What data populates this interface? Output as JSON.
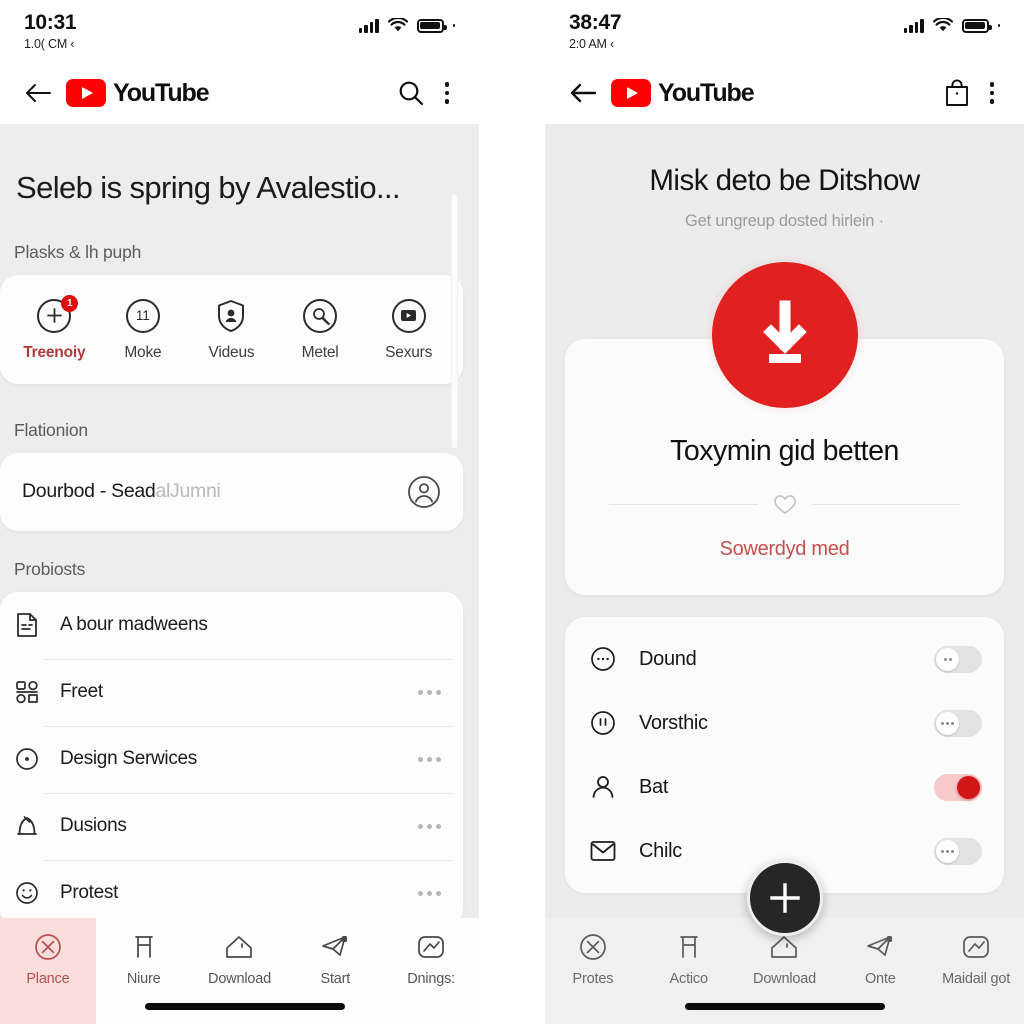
{
  "left": {
    "status": {
      "time": "10:31",
      "subtitle": "1.0( CM ‹",
      "signal_icon": "cellular-bars-icon",
      "wifi_icon": "wifi-icon",
      "battery_icon": "battery-full-icon"
    },
    "appbar": {
      "back_icon": "back-arrow-icon",
      "brand": "YouTube",
      "search_icon": "search-icon",
      "menu_icon": "kebab-menu-icon"
    },
    "page_title": "Seleb is spring by Avalestio...",
    "sections": {
      "quick_label": "Plasks & lh puph",
      "search_label": "Flationion",
      "list_label": "Probiosts"
    },
    "quick_actions": [
      {
        "label": "Treenoiy",
        "icon": "plus-circle-icon",
        "badge": "1",
        "active": true
      },
      {
        "label": "Moke",
        "icon": "number-eleven-circle-icon",
        "badge": "",
        "active": false
      },
      {
        "label": "Videus",
        "icon": "shield-person-icon",
        "badge": "",
        "active": false
      },
      {
        "label": "Metel",
        "icon": "search-circle-icon",
        "badge": "",
        "active": false
      },
      {
        "label": "Sexurs",
        "icon": "media-card-circle-icon",
        "badge": "",
        "active": false
      }
    ],
    "search": {
      "value": "Dourbod - Sead",
      "ghost": "alJumni",
      "avatar_icon": "account-circle-icon"
    },
    "list": [
      {
        "label": "A bour madweens",
        "icon": "document-lines-icon",
        "more": false
      },
      {
        "label": "Freet",
        "icon": "grid-shapes-icon",
        "more": true
      },
      {
        "label": "Design Serwices",
        "icon": "dot-circle-icon",
        "more": true
      },
      {
        "label": "Dusions",
        "icon": "bell-dome-icon",
        "more": true
      },
      {
        "label": "Protest",
        "icon": "smiley-face-icon",
        "more": true
      }
    ],
    "tabs": [
      {
        "label": "Plance",
        "icon": "x-circle-icon",
        "active": true
      },
      {
        "label": "Niure",
        "icon": "stool-icon",
        "active": false
      },
      {
        "label": "Download",
        "icon": "house-icon",
        "active": false
      },
      {
        "label": "Start",
        "icon": "paper-plane-icon",
        "active": false
      },
      {
        "label": "Dnings:",
        "icon": "chart-square-icon",
        "active": false
      }
    ]
  },
  "right": {
    "status": {
      "time": "38:47",
      "subtitle": "2:0 AM ‹",
      "signal_icon": "cellular-bars-icon",
      "wifi_icon": "wifi-icon",
      "battery_icon": "battery-full-icon"
    },
    "appbar": {
      "back_icon": "back-arrow-icon",
      "brand": "YouTube",
      "bag_icon": "shopping-bag-icon",
      "menu_icon": "kebab-menu-icon"
    },
    "page_title": "Misk deto be Ditshow",
    "page_subtitle": "Get ungreup dosted hirlein ·",
    "download_icon": "download-circle-icon",
    "hero": {
      "heading": "Toxymin gid betten",
      "divider_icon": "heart-outline-icon",
      "link": "Sowerdyd med"
    },
    "settings": [
      {
        "label": "Dound",
        "icon": "chat-dots-circle-icon",
        "on": false
      },
      {
        "label": "Vorsthic",
        "icon": "pause-circle-icon",
        "on": false
      },
      {
        "label": "Bat",
        "icon": "person-icon",
        "on": true
      },
      {
        "label": "Chilc",
        "icon": "mail-envelope-icon",
        "on": false
      }
    ],
    "fab": {
      "icon": "plus-icon"
    },
    "tabs": [
      {
        "label": "Protes",
        "icon": "x-circle-icon",
        "active": false
      },
      {
        "label": "Actico",
        "icon": "stool-icon",
        "active": false
      },
      {
        "label": "Download",
        "icon": "house-icon",
        "active": false
      },
      {
        "label": "Onte",
        "icon": "paper-plane-icon",
        "active": false
      },
      {
        "label": "Maidail got",
        "icon": "chart-square-icon",
        "active": false
      }
    ]
  },
  "colors": {
    "brand_red": "#ff0000",
    "accent_red": "#e0211f",
    "active_tab_bg": "#fadede",
    "panel_bg": "#ededed"
  }
}
